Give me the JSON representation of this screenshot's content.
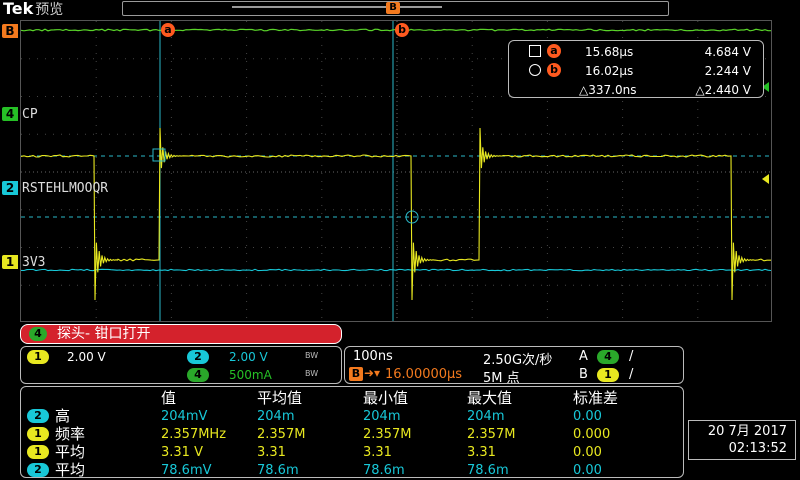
{
  "header": {
    "brand": "Tek",
    "mode": "预览"
  },
  "channels": [
    {
      "id": "B",
      "marker": "B",
      "label": "",
      "color": "#f47a1e"
    },
    {
      "id": "4",
      "marker": "4",
      "label": "CP",
      "color": "#26c026"
    },
    {
      "id": "2",
      "marker": "2",
      "label": "RSTEHLMOOQR",
      "color": "#18c8d8"
    },
    {
      "id": "1",
      "marker": "1",
      "label": "3V3",
      "color": "#e8e820"
    }
  ],
  "trigger_position_marker": "B",
  "cursors": {
    "a": {
      "badge": "a",
      "time": "15.68µs",
      "value": "4.684 V"
    },
    "b": {
      "badge": "b",
      "time": "16.02µs",
      "value": "2.244 V"
    },
    "delta": {
      "time": "△337.0ns",
      "value": "△2.440 V"
    }
  },
  "message": {
    "channel": "4",
    "text": "探头- 钳口打开"
  },
  "vertical": {
    "ch1": {
      "num": "1",
      "scale": "2.00 V",
      "bw": "BW"
    },
    "ch2": {
      "num": "2",
      "scale": "2.00 V",
      "bw": "BW"
    },
    "ch4": {
      "num": "4",
      "scale": "500mA",
      "bw": "BW"
    }
  },
  "horizontal": {
    "timebase": "100ns",
    "sample_rate": "2.50G次/秒",
    "delay_icon": "B",
    "delay": "16.00000µs",
    "record_length": "5M 点",
    "trig_a_label": "A",
    "trig_a_source": "4",
    "trig_a_slope": "/",
    "trig_b_label": "B",
    "trig_b_source": "1",
    "trig_b_slope": "/"
  },
  "measurements": {
    "headers": [
      "值",
      "平均值",
      "最小值",
      "最大值",
      "标准差"
    ],
    "rows": [
      {
        "ch": "2",
        "name": "高",
        "color": "#18c8d8",
        "values": [
          "204mV",
          "204m",
          "204m",
          "204m",
          "0.00"
        ]
      },
      {
        "ch": "1",
        "name": "频率",
        "color": "#e8e820",
        "values": [
          "2.357MHz",
          "2.357M",
          "2.357M",
          "2.357M",
          "0.000"
        ]
      },
      {
        "ch": "1",
        "name": "平均",
        "color": "#e8e820",
        "values": [
          "3.31 V",
          "3.31",
          "3.31",
          "3.31",
          "0.00"
        ]
      },
      {
        "ch": "2",
        "name": "平均",
        "color": "#18c8d8",
        "values": [
          "78.6mV",
          "78.6m",
          "78.6m",
          "78.6m",
          "0.00"
        ]
      }
    ]
  },
  "datetime": {
    "date": "20 7月 2017",
    "time": "02:13:52"
  }
}
